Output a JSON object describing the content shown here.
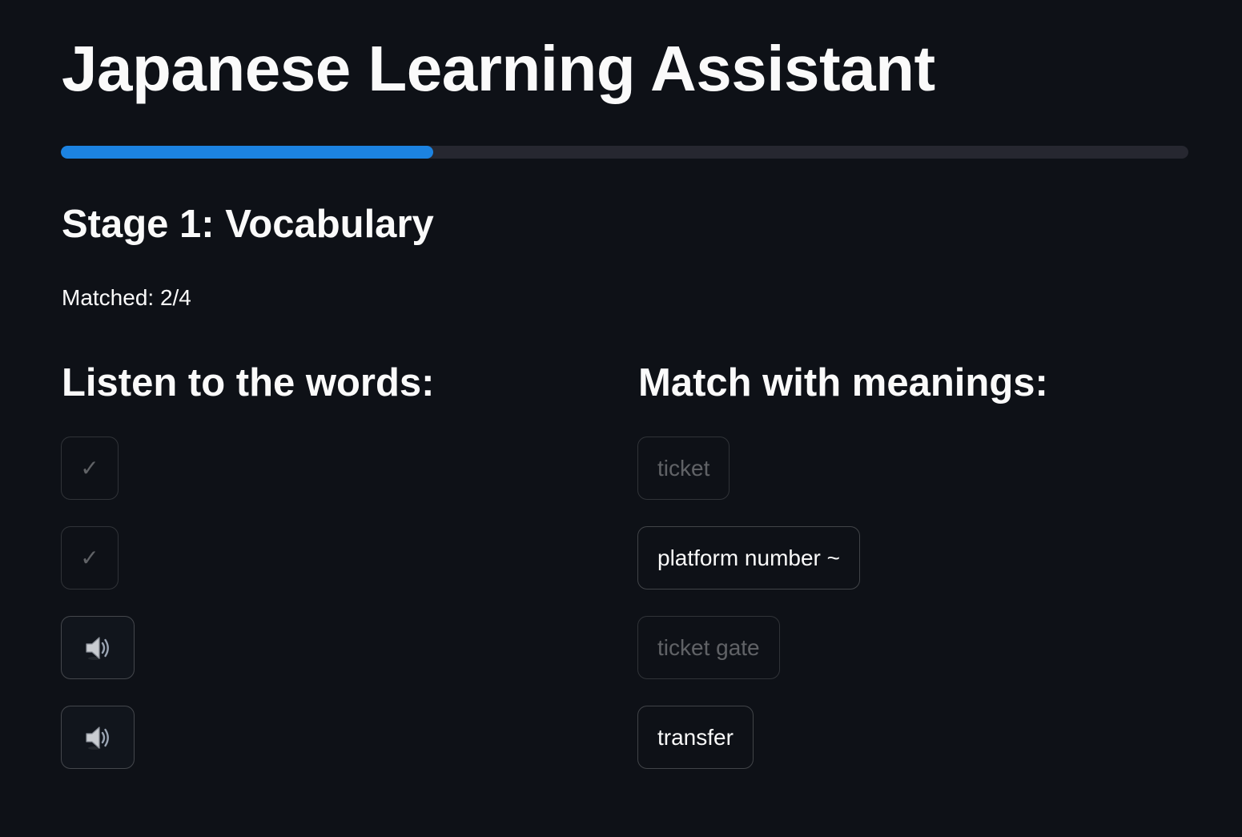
{
  "app": {
    "title": "Japanese Learning Assistant"
  },
  "progress": {
    "value_percent": 33,
    "fill_color": "#1c83e1",
    "track_color": "#262730"
  },
  "stage": {
    "heading": "Stage 1: Vocabulary",
    "matched_label": "Matched: 2/4"
  },
  "listen_column": {
    "heading": "Listen to the words:",
    "items": [
      {
        "state": "matched",
        "icon": "check-icon",
        "label": "✓"
      },
      {
        "state": "matched",
        "icon": "check-icon",
        "label": "✓"
      },
      {
        "state": "active",
        "icon": "speaker-icon"
      },
      {
        "state": "active",
        "icon": "speaker-icon"
      }
    ]
  },
  "meaning_column": {
    "heading": "Match with meanings:",
    "items": [
      {
        "label": "ticket",
        "state": "disabled"
      },
      {
        "label": "platform number ~",
        "state": "active"
      },
      {
        "label": "ticket gate",
        "state": "disabled"
      },
      {
        "label": "transfer",
        "state": "active"
      }
    ]
  },
  "colors": {
    "background": "#0e1117",
    "text": "#fafafa",
    "accent": "#1c83e1"
  }
}
